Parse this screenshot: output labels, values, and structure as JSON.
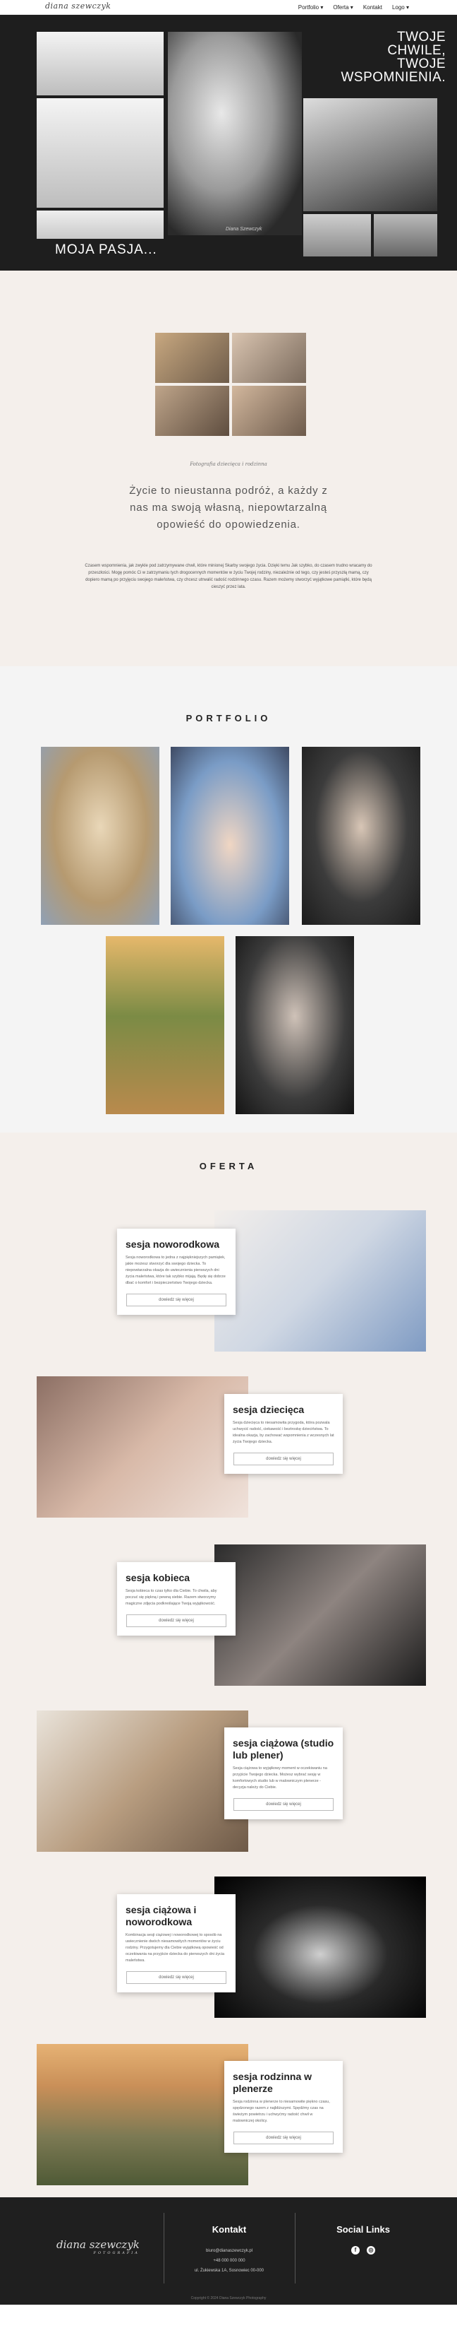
{
  "nav": {
    "logo": "diana szewczyk",
    "items": [
      "Portfolio ▾",
      "Oferta ▾",
      "Kontakt",
      "Logo ▾"
    ]
  },
  "hero": {
    "title_right": [
      "TWOJE",
      "CHWILE,",
      "TWOJE",
      "WSPOMNIENIA."
    ],
    "title_left": "MOJA PASJA...",
    "signature": "Diana Szewczyk"
  },
  "about": {
    "small_caption": "Fotografia dziecięca i rodzinna",
    "quote": "Życie to nieustanna podróż, a każdy z nas ma swoją własną, niepowtarzalną opowieść do opowiedzenia.",
    "text": "Czasem wspomnienia, jak zwykle pod zatrzymywane chwil, które minionej Skarby swojego życia. Dzięki temu Jak szybko, do czasem trudno wracamy do przeszłości. Mogę pomóc Ci w zatrzymaniu tych drogocennych momentów w życiu Twojej rodziny, niezależnie od tego, czy jesteś przyszłą mamą, czy dopiero mamą po przyjęciu swojego maleństwa, czy chcesz utrwalić radość rodzinnego czasu. Razem możemy stworzyć wyjątkowe pamiątki, które będą cieszyć przez lata."
  },
  "portfolio": {
    "title": "PORTFOLIO"
  },
  "oferta": {
    "title": "OFERTA",
    "items": [
      {
        "title": "sesja noworodkowa",
        "text": "Sesja noworodkowa to jedna z najpiękniejszych pamiątek, jakie możesz stworzyć dla swojego dziecka. To niepowtarzalna okazja do uwiecznienia pierwszych dni życia maleństwa, które tak szybko mijają. Będę się dobrze dbać o komfort i bezpieczeństwo Twojego dziecka.",
        "button": "dowiedz się więcej"
      },
      {
        "title": "sesja dziecięca",
        "text": "Sesja dziecięca to niesamowita przygoda, która pozwala uchwycić radość, ciekawość i beztroskę dzieciństwa. To idealna okazja, by zachować wspomnienia z wczesnych lat życia Twojego dziecka.",
        "button": "dowiedz się więcej"
      },
      {
        "title": "sesja kobieca",
        "text": "Sesja kobieca to czas tylko dla Ciebie. To chwila, aby poczuć się piękną i pewną siebie. Razem stworzymy magiczne zdjęcia podkreślające Twoją wyjątkowość.",
        "button": "dowiedz się więcej"
      },
      {
        "title": "sesja ciążowa (studio lub plener)",
        "text": "Sesja ciążowa to wyjątkowy moment w oczekiwaniu na przyjście Twojego dziecka. Możesz wybrać sesję w komfortowych studio lub w malowniczym plenerze - decyzja należy do Ciebie.",
        "button": "dowiedz się więcej"
      },
      {
        "title": "sesja ciążowa i noworodkowa",
        "text": "Kombinacja sesji ciążowej i noworodkowej to sposób na uwiecznienie dwóch niesamowitych momentów w życiu rodziny. Przygotujemy dla Ciebie wyjątkową opowieść od oczekiwania na przyjście dziecka do pierwszych dni życia maleństwa.",
        "button": "dowiedz się więcej"
      },
      {
        "title": "sesja rodzinna w plenerze",
        "text": "Sesja rodzinna w plenerze to niesamowite piękno czasu, spędzonego razem z najbliższymi. Spędźmy czas na świeżym powietrzu i uchwyćmy radość chwil w malowniczej okolicy.",
        "button": "dowiedz się więcej"
      }
    ]
  },
  "footer": {
    "logo": "diana szewczyk",
    "logo_sub": "FOTOGRAFIA",
    "contact_title": "Kontakt",
    "email": "biuro@dianaszewczyk.pl",
    "phone": "+48 000 000 000",
    "address": "ul. Żukiewska 1A, Sosnowiec 00-000",
    "social_title": "Social Links",
    "copyright": "Copyright © 2024 Diana Szewczyk Photography"
  }
}
